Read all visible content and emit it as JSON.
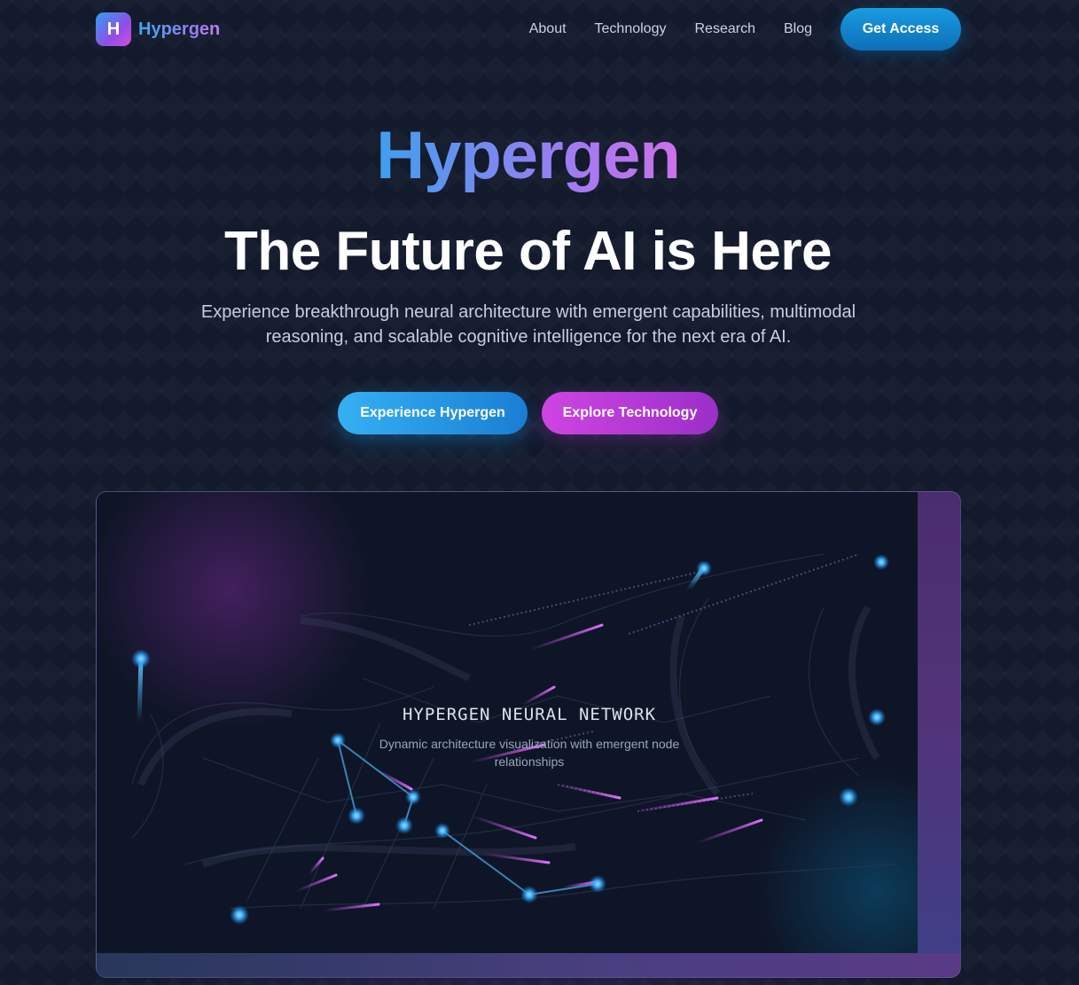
{
  "nav": {
    "brand_letter": "H",
    "brand_name": "Hypergen",
    "links": [
      "About",
      "Technology",
      "Research",
      "Blog"
    ],
    "cta_label": "Get Access"
  },
  "hero": {
    "brand": "Hypergen",
    "title": "The Future of AI is Here",
    "subtitle": "Experience breakthrough neural architecture with emergent capabilities, multimodal reasoning, and scalable cognitive intelligence for the next era of AI.",
    "primary_cta": "Experience Hypergen",
    "secondary_cta": "Explore Technology"
  },
  "visual": {
    "title": "HYPERGEN NEURAL NETWORK",
    "subtitle": "Dynamic architecture visualization with emergent node relationships"
  },
  "colors": {
    "background": "#121a2c",
    "accent_blue": "#1a9be0",
    "accent_magenta": "#cf45e2",
    "node_blue": "#49b8ff",
    "trail_pink": "#d24cf0"
  }
}
